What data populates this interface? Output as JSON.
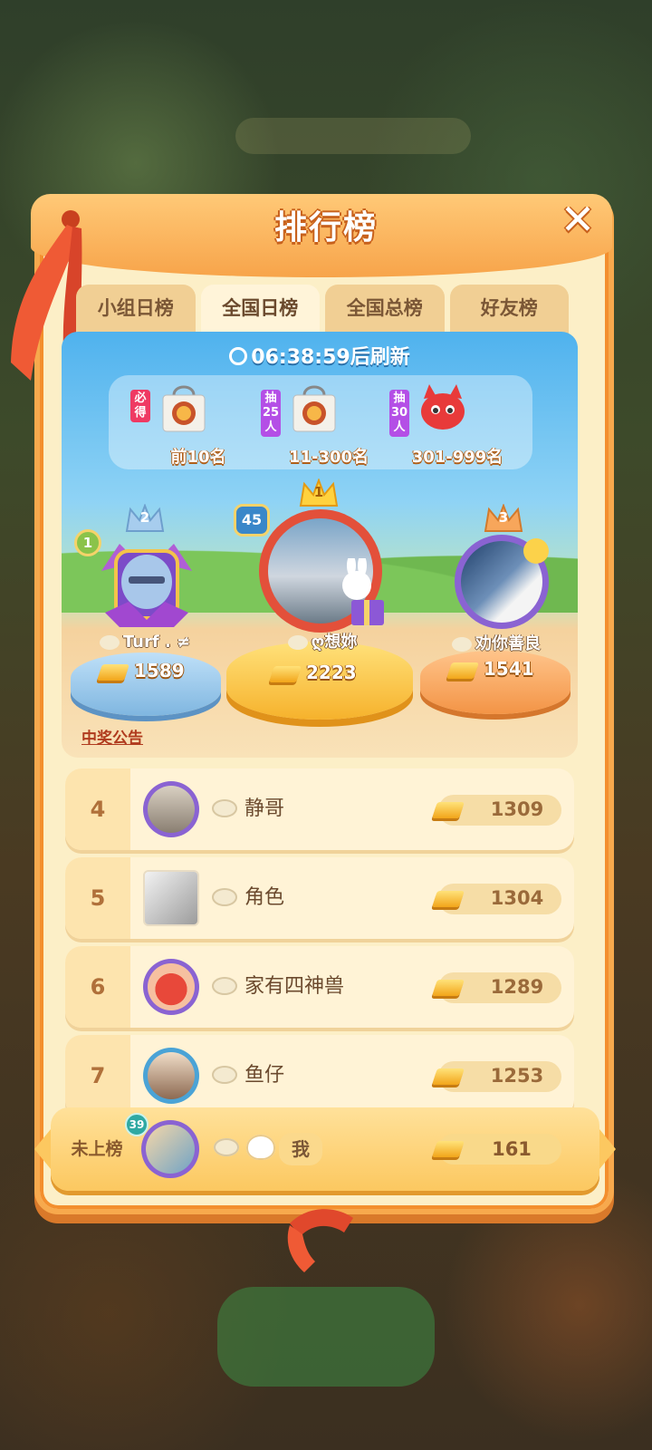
{
  "panel": {
    "title": "排行榜",
    "close_label": "✕"
  },
  "tabs": [
    {
      "label": "小组日榜",
      "active": false
    },
    {
      "label": "全国日榜",
      "active": true
    },
    {
      "label": "全国总榜",
      "active": false
    },
    {
      "label": "好友榜",
      "active": false
    }
  ],
  "arena": {
    "refresh_text": "06:38:59后刷新",
    "prizes": [
      {
        "tag": "必得",
        "label": "前10名"
      },
      {
        "tag": "抽25人",
        "label": "11-300名"
      },
      {
        "tag": "抽30人",
        "label": "301-999名"
      }
    ]
  },
  "podium": [
    {
      "place": "2",
      "badge": "1",
      "name": "Turf . ≠",
      "score": "1589"
    },
    {
      "place": "1",
      "badge": "45",
      "name": "ღ想妳",
      "score": "2223"
    },
    {
      "place": "3",
      "name": "劝你善良",
      "score": "1541"
    }
  ],
  "notice_label": "中奖公告",
  "ranking": [
    {
      "rank": "4",
      "name": "静哥",
      "score": "1309"
    },
    {
      "rank": "5",
      "name": "角色",
      "score": "1304"
    },
    {
      "rank": "6",
      "name": "家有四神兽",
      "score": "1289"
    },
    {
      "rank": "7",
      "name": "鱼仔",
      "score": "1253"
    }
  ],
  "mine": {
    "rank_label": "未上榜",
    "level": "39",
    "name": "我",
    "score": "161"
  },
  "colors": {
    "accent": "#f7a44a",
    "panel": "#fcefc7",
    "gold": "#f2a51a",
    "sky": "#4fb2ee"
  }
}
